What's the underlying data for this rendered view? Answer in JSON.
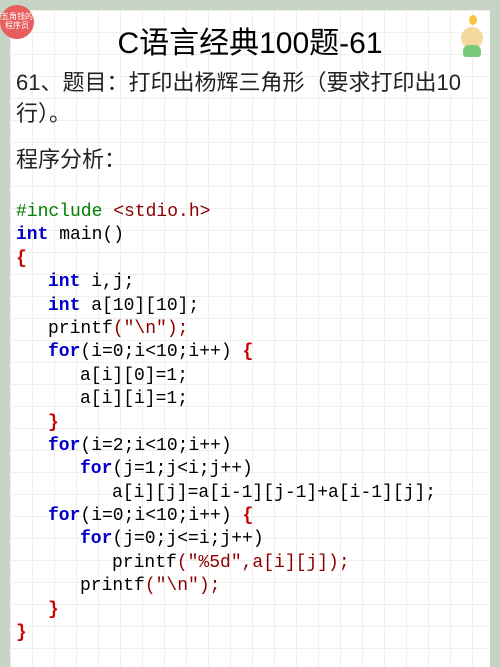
{
  "badge_text": "五角钱的程序员",
  "title": "C语言经典100题-61",
  "problem": "61、题目：打印出杨辉三角形（要求打印出10行）。",
  "analysis_label": "程序分析：",
  "code": {
    "include_kw": "#include",
    "include_lib": " <stdio.h>",
    "int": "int",
    "main": " main()",
    "lbrace": "{",
    "rbrace": "}",
    "decl_ij": " i,j;",
    "decl_arr": " a[10][10];",
    "printf": "printf",
    "printf_nl_args": "(\"\\n\");",
    "for1": "(i=0;i<10;i++) ",
    "a_i_0": "a[i][0]=1;",
    "a_i_i": "a[i][i]=1;",
    "for2": "(i=2;i<10;i++)",
    "for2_inner": "(j=1;j<i;j++)",
    "assign": "a[i][j]=a[i-1][j-1]+a[i-1][j];",
    "for3": "(i=0;i<10;i++) ",
    "for3_inner": "(j=0;j<=i;j++)",
    "printf_fmt_args": "(\"%5d\",a[i][j]);",
    "for_kw": "for"
  }
}
